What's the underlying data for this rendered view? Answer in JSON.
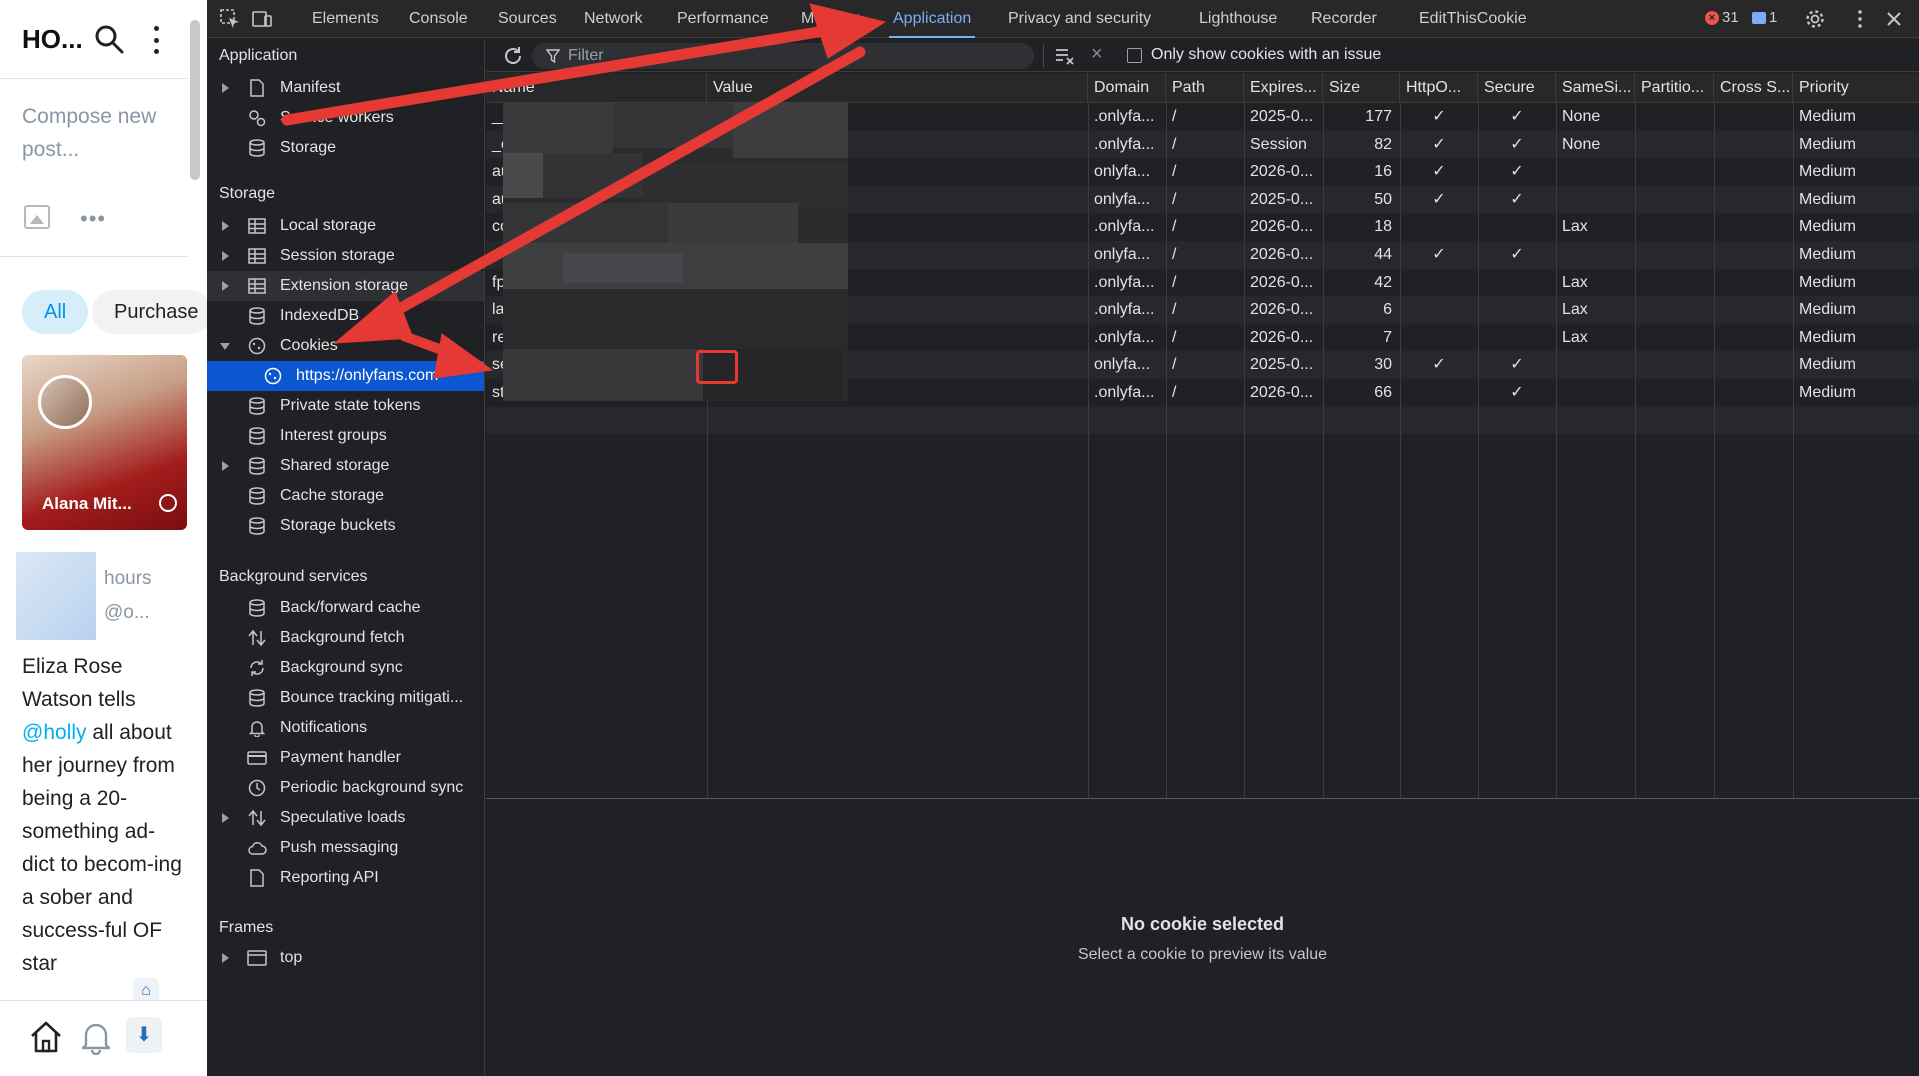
{
  "webpage": {
    "title": "HO...",
    "compose_placeholder": "Compose new post...",
    "more_label": "•••",
    "chips": {
      "all": "All",
      "purchased": "Purchase"
    },
    "card": {
      "name": "Alana Mit..."
    },
    "thumb_meta": {
      "time": "hours",
      "handle": "@o..."
    },
    "article": {
      "lead": "Eliza Rose Watson tells ",
      "mention": "@holly",
      "rest": " all about her journey from being a 20-something ad-dict to becom-ing a sober and success-ful OF star"
    }
  },
  "devtools": {
    "tabs": [
      "Elements",
      "Console",
      "Sources",
      "Network",
      "Performance",
      "Memory",
      "Application",
      "Privacy and security",
      "Lighthouse",
      "Recorder",
      "EditThisCookie"
    ],
    "active_tab": "Application",
    "error_count": "31",
    "message_count": "1",
    "sidebar": {
      "application_header": "Application",
      "application_items": [
        "Manifest",
        "Service workers",
        "Storage"
      ],
      "storage_header": "Storage",
      "storage_items": [
        "Local storage",
        "Session storage",
        "Extension storage",
        "IndexedDB",
        "Cookies",
        "https://onlyfans.com",
        "Private state tokens",
        "Interest groups",
        "Shared storage",
        "Cache storage",
        "Storage buckets"
      ],
      "background_header": "Background services",
      "background_items": [
        "Back/forward cache",
        "Background fetch",
        "Background sync",
        "Bounce tracking mitigati...",
        "Notifications",
        "Payment handler",
        "Periodic background sync",
        "Speculative loads",
        "Push messaging",
        "Reporting API"
      ],
      "frames_header": "Frames",
      "frames_items": [
        "top"
      ]
    },
    "toolbar": {
      "filter_placeholder": "Filter",
      "issue_checkbox_label": "Only show cookies with an issue"
    },
    "table": {
      "columns": [
        "Name",
        "Value",
        "Domain",
        "Path",
        "Expires...",
        "Size",
        "HttpO...",
        "Secure",
        "SameSi...",
        "Partitio...",
        "Cross S...",
        "Priority"
      ],
      "rows": [
        {
          "name": "__cf_bm",
          "domain": ".onlyfa...",
          "path": "/",
          "expires": "2025-0...",
          "size": "177",
          "httponly": "✓",
          "secure": "✓",
          "samesite": "None",
          "priority": "Medium"
        },
        {
          "name": "_cfuvid",
          "domain": ".onlyfa...",
          "path": "/",
          "expires": "Session",
          "size": "82",
          "httponly": "✓",
          "secure": "✓",
          "samesite": "None",
          "priority": "Medium"
        },
        {
          "name": "auth_id",
          "domain": "onlyfa...",
          "path": "/",
          "expires": "2026-0...",
          "size": "16",
          "httponly": "✓",
          "secure": "✓",
          "samesite": "",
          "priority": "Medium"
        },
        {
          "name": "auth_uid_486",
          "domain": "onlyfa...",
          "path": "/",
          "expires": "2025-0...",
          "size": "50",
          "httponly": "✓",
          "secure": "✓",
          "samesite": "",
          "priority": "Medium"
        },
        {
          "name": "cookie",
          "domain": ".onlyfa...",
          "path": "/",
          "expires": "2026-0...",
          "size": "18",
          "httponly": "",
          "secure": "",
          "samesite": "Lax",
          "priority": "Medium"
        },
        {
          "name": "",
          "domain": "onlyfa...",
          "path": "/",
          "expires": "2026-0...",
          "size": "44",
          "httponly": "✓",
          "secure": "✓",
          "samesite": "",
          "priority": "Medium"
        },
        {
          "name": "fp",
          "domain": ".onlyfa...",
          "path": "/",
          "expires": "2026-0...",
          "size": "42",
          "httponly": "",
          "secure": "",
          "samesite": "Lax",
          "priority": "Medium"
        },
        {
          "name": "lang",
          "domain": ".onlyfa...",
          "path": "/",
          "expires": "2026-0...",
          "size": "6",
          "httponly": "",
          "secure": "",
          "samesite": "Lax",
          "priority": "Medium"
        },
        {
          "name": "ref_src",
          "domain": ".onlyfa...",
          "path": "/",
          "expires": "2026-0...",
          "size": "7",
          "httponly": "",
          "secure": "",
          "samesite": "Lax",
          "priority": "Medium"
        },
        {
          "name": "sess",
          "domain": "onlyfa...",
          "path": "/",
          "expires": "2025-0...",
          "size": "30",
          "httponly": "✓",
          "secure": "✓",
          "samesite": "",
          "priority": "Medium"
        },
        {
          "name": "st",
          "domain": ".onlyfa...",
          "path": "/",
          "expires": "2026-0...",
          "size": "66",
          "httponly": "",
          "secure": "✓",
          "samesite": "",
          "priority": "Medium"
        }
      ]
    },
    "preview": {
      "title": "No cookie selected",
      "subtitle": "Select a cookie to preview its value"
    },
    "colors": {
      "accent": "#7cacf8",
      "selected": "#0b57d0",
      "annotation": "#e53935"
    }
  }
}
